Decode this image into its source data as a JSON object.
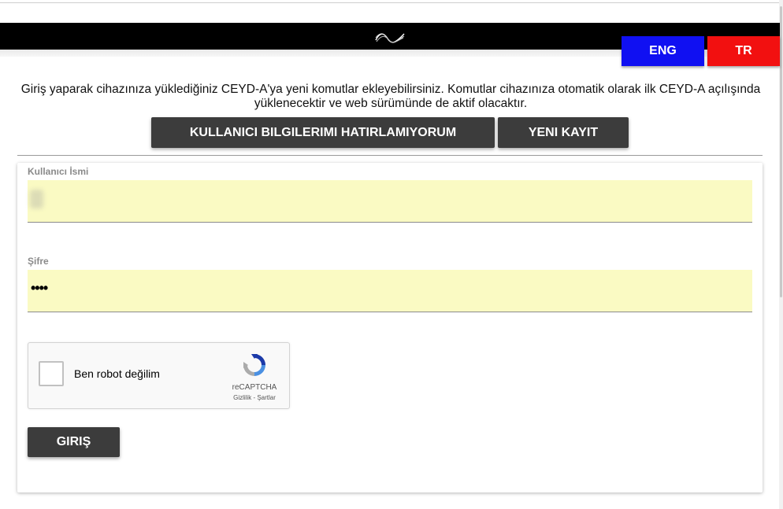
{
  "header": {
    "logo_icon": "ceyda-wave-logo-icon"
  },
  "language": {
    "eng_label": "ENG",
    "tr_label": "TR",
    "eng_color": "#1010f2",
    "tr_color": "#f21010"
  },
  "intro_text": "Giriş yaparak cihazınıza yüklediğiniz CEYD-A'ya yeni komutlar ekleyebilirsiniz. Komutlar cihazınıza otomatik olarak ilk CEYD-A açılışında yüklenecektir ve web sürümünde de aktif olacaktır.",
  "actions": {
    "forgot_label": "KULLANICI BILGILERIMI HATIRLAMIYORUM",
    "register_label": "YENI KAYIT"
  },
  "form": {
    "username_label": "Kullanıcı İsmi",
    "password_label": "Şifre",
    "password_value": "••••",
    "login_label": "GIRIŞ"
  },
  "captcha": {
    "label": "Ben robot değilim",
    "brand": "reCAPTCHA",
    "links": "Gizlilik - Şartlar",
    "icon": "recaptcha-icon"
  }
}
